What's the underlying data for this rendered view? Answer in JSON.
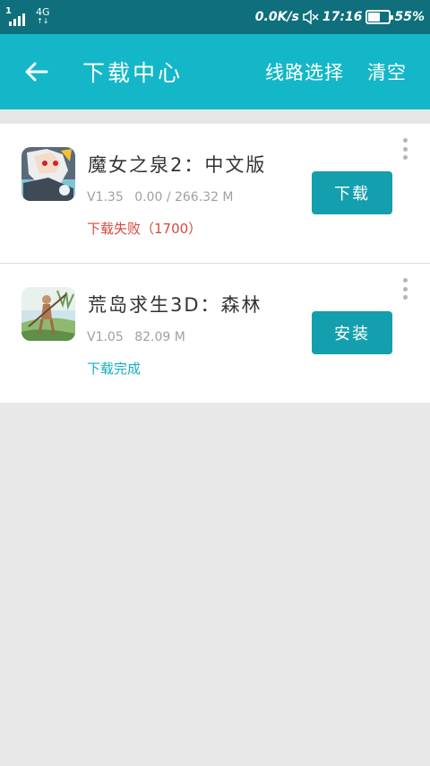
{
  "status_bar": {
    "sim_slot": "1",
    "network": "4G",
    "network_arrows": "↑↓",
    "speed": "0.0K/s",
    "time": "17:16",
    "battery": "55%",
    "battery_level": 0.55
  },
  "toolbar": {
    "back_icon": "arrow-left-icon",
    "title": "下载中心",
    "route_label": "线路选择",
    "clear_label": "清空"
  },
  "downloads": [
    {
      "name": "魔女之泉2：中文版",
      "version": "V1.35",
      "size": "0.00 / 266.32 M",
      "status": "下载失败（1700）",
      "status_type": "failed",
      "button": "下载",
      "icon": "anime-girl-app-icon"
    },
    {
      "name": "荒岛求生3D：森林",
      "version": "V1.05",
      "size": "82.09 M",
      "status": "下载完成",
      "status_type": "done",
      "button": "安装",
      "icon": "island-survivor-app-icon"
    }
  ],
  "colors": {
    "status_bar": "#0f6f7c",
    "toolbar": "#14b7c8",
    "button": "#149fae",
    "failed_text": "#d9473b",
    "done_text": "#14aec1",
    "background": "#e8e8e8"
  }
}
